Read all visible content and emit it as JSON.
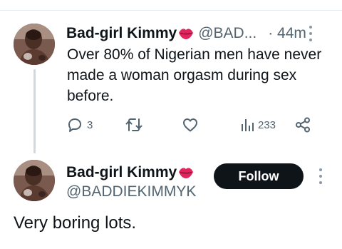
{
  "tweet": {
    "author_name": "Bad-girl Kimmy",
    "author_handle": "@BAD...",
    "time": "· 44m",
    "text": "Over 80% of Nigerian men have never made a woman orgasm during sex before.",
    "reply_count": "3",
    "view_count": "233",
    "icons": {
      "reply": "comment-icon",
      "retweet": "retweet-icon",
      "like": "heart-icon",
      "views": "views-chart-icon",
      "share": "share-icon",
      "more": "more-vertical-icon",
      "badge": "lips-emoji-icon"
    }
  },
  "profile": {
    "author_name": "Bad-girl Kimmy",
    "author_handle": "@BADDIEKIMMYK",
    "follow_label": "Follow",
    "reply_text": "Very boring lots."
  },
  "colors": {
    "text": "#0f1419",
    "secondary": "#536471",
    "thread_line": "#cfd9de",
    "follow_bg": "#0f1419",
    "lips": "#e0245e"
  }
}
